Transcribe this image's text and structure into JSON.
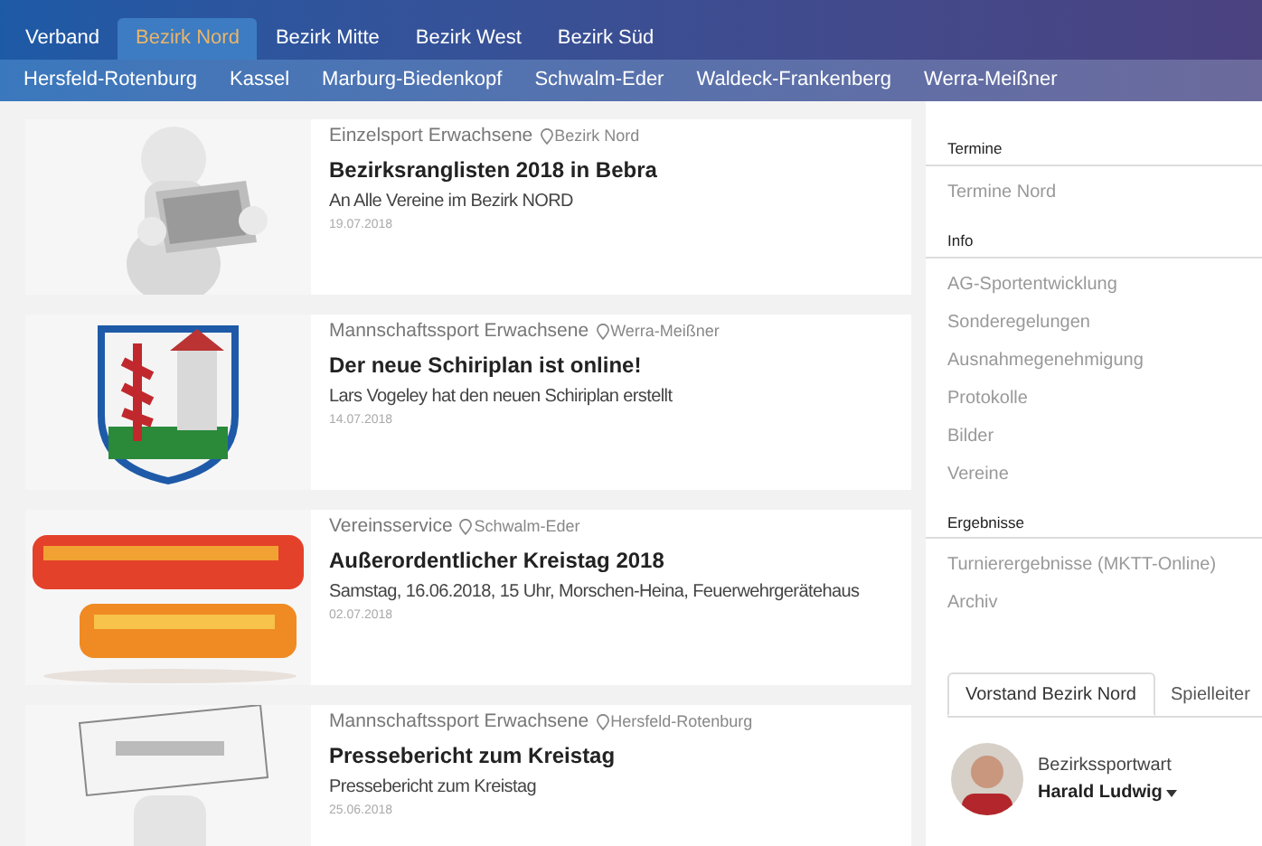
{
  "nav": {
    "tabs": [
      {
        "label": "Verband",
        "selected": false
      },
      {
        "label": "Bezirk Nord",
        "selected": true
      },
      {
        "label": "Bezirk Mitte",
        "selected": false
      },
      {
        "label": "Bezirk West",
        "selected": false
      },
      {
        "label": "Bezirk Süd",
        "selected": false
      }
    ]
  },
  "subnav": [
    "Hersfeld-Rotenburg",
    "Kassel",
    "Marburg-Biedenkopf",
    "Schwalm-Eder",
    "Waldeck-Frankenberg",
    "Werra-Meißner"
  ],
  "articles": [
    {
      "category": "Einzelsport Erwachsene",
      "location": "Bezirk Nord",
      "title": "Bezirksranglisten 2018 in Bebra",
      "summary": "An Alle Vereine im Bezirk NORD",
      "date": "19.07.2018"
    },
    {
      "category": "Mannschaftssport Erwachsene",
      "location": "Werra-Meißner",
      "title": "Der neue Schiriplan ist online!",
      "summary": "Lars Vogeley hat den neuen Schiriplan erstellt",
      "date": "14.07.2018"
    },
    {
      "category": "Vereinsservice",
      "location": "Schwalm-Eder",
      "title": "Außerordentlicher Kreistag 2018",
      "summary": "Samstag, 16.06.2018, 15 Uhr, Morschen-Heina, Feuerwehrgerätehaus",
      "date": "02.07.2018"
    },
    {
      "category": "Mannschaftssport Erwachsene",
      "location": "Hersfeld-Rotenburg",
      "title": "Pressebericht zum Kreistag",
      "summary": "Pressebericht zum Kreistag",
      "date": "25.06.2018"
    }
  ],
  "sidebar": {
    "sections": [
      {
        "heading": "Termine",
        "items": [
          "Termine Nord"
        ]
      },
      {
        "heading": "Info",
        "items": [
          "AG-Sportentwicklung",
          "Sonderegelungen",
          "Ausnahmegenehmigung",
          "Protokolle",
          "Bilder",
          "Vereine"
        ]
      },
      {
        "heading": "Ergebnisse",
        "items": [
          "Turnierergebnisse (MKTT-Online)",
          "Archiv"
        ]
      }
    ],
    "tabs": [
      {
        "label": "Vorstand Bezirk Nord",
        "selected": true
      },
      {
        "label": "Spielleiter",
        "selected": false
      }
    ],
    "contact": {
      "role": "Bezirkssportwart",
      "name": "Harald Ludwig"
    }
  }
}
